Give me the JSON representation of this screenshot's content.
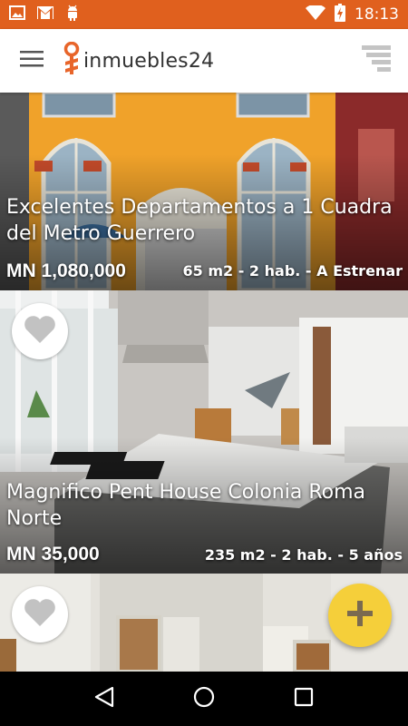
{
  "status_bar": {
    "time": "18:13",
    "icons": [
      "image-icon",
      "gmail-icon",
      "android-icon",
      "wifi-icon",
      "battery-charging-icon"
    ]
  },
  "app_bar": {
    "brand_name": "inmuebles24",
    "menu_icon": "hamburger-menu-icon",
    "filter_icon": "filter-icon"
  },
  "listings": [
    {
      "title": "Excelentes Departamentos a 1 Cuadra del Metro Guerrero",
      "price": "MN 1,080,000",
      "details": "65 m2 - 2 hab. - A Estrenar"
    },
    {
      "title": "Magnifico Pent House Colonia Roma Norte",
      "price": "MN 35,000",
      "details": "235 m2 - 2 hab. - 5 años"
    },
    {
      "title": "",
      "price": "",
      "details": ""
    }
  ],
  "fab": {
    "icon": "plus-icon"
  },
  "nav_bar": {
    "icons": [
      "back-icon",
      "home-icon",
      "recents-icon"
    ]
  },
  "colors": {
    "status_bar": "#e0601e",
    "brand_orange": "#e8652a",
    "fab": "#f5cf3a"
  }
}
